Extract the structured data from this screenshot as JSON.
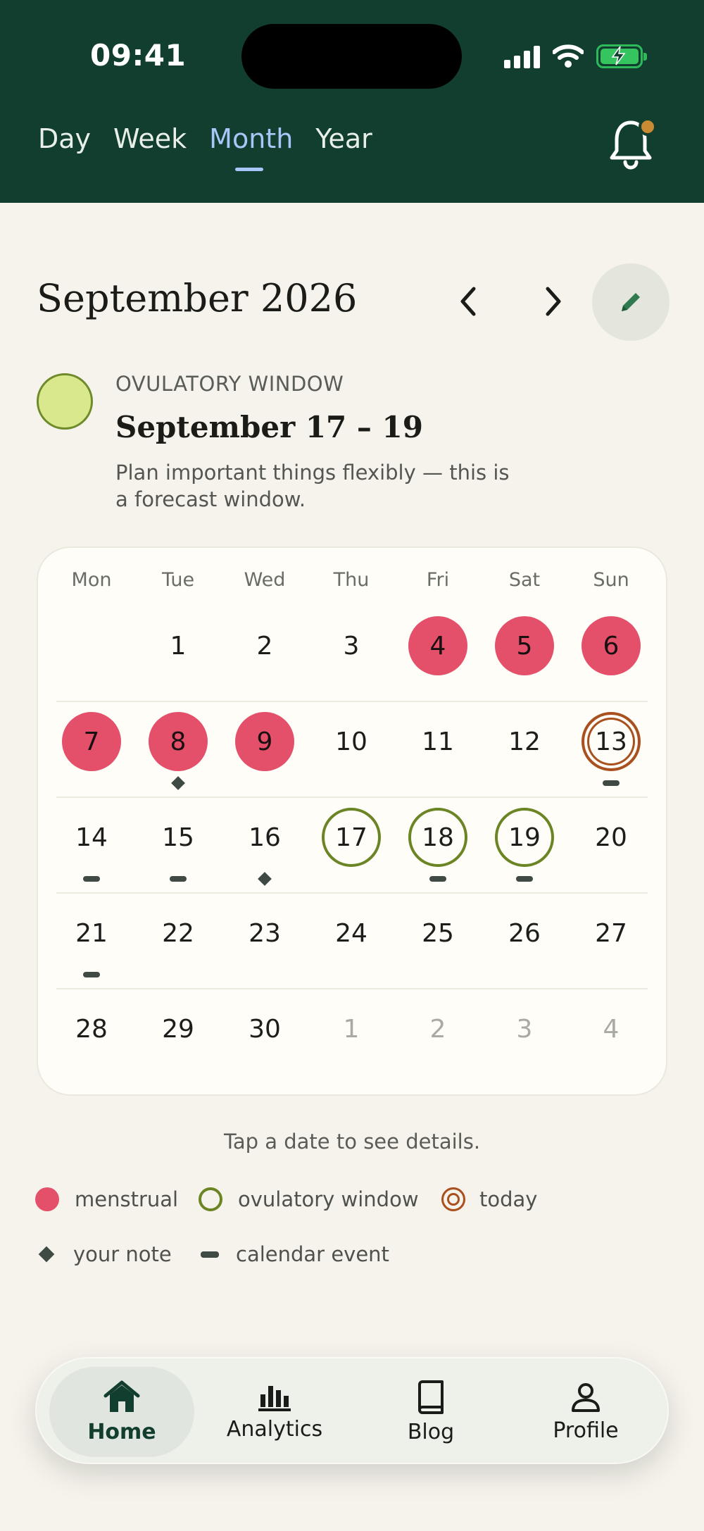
{
  "status_bar": {
    "time": "09:41"
  },
  "view_tabs": [
    "Day",
    "Week",
    "Month",
    "Year"
  ],
  "active_tab": "Month",
  "month_title": "September 2026",
  "phase": {
    "label": "OVULATORY WINDOW",
    "range": "September 17 – 19",
    "note_line1": "Plan important things flexibly — this is",
    "note_line2": "a forecast window."
  },
  "weekdays": [
    "Mon",
    "Tue",
    "Wed",
    "Thu",
    "Fri",
    "Sat",
    "Sun"
  ],
  "weeks": [
    [
      {
        "d": ""
      },
      {
        "d": "1"
      },
      {
        "d": "2"
      },
      {
        "d": "3"
      },
      {
        "d": "4",
        "s": "menstrual"
      },
      {
        "d": "5",
        "s": "menstrual"
      },
      {
        "d": "6",
        "s": "menstrual"
      }
    ],
    [
      {
        "d": "7",
        "s": "menstrual"
      },
      {
        "d": "8",
        "s": "menstrual",
        "m": "note"
      },
      {
        "d": "9",
        "s": "menstrual"
      },
      {
        "d": "10"
      },
      {
        "d": "11"
      },
      {
        "d": "12"
      },
      {
        "d": "13",
        "s": "today",
        "m": "event"
      }
    ],
    [
      {
        "d": "14",
        "m": "event"
      },
      {
        "d": "15",
        "m": "event"
      },
      {
        "d": "16",
        "m": "note"
      },
      {
        "d": "17",
        "s": "ovulatory"
      },
      {
        "d": "18",
        "s": "ovulatory",
        "m": "event"
      },
      {
        "d": "19",
        "s": "ovulatory",
        "m": "event"
      },
      {
        "d": "20"
      }
    ],
    [
      {
        "d": "21",
        "m": "event"
      },
      {
        "d": "22"
      },
      {
        "d": "23"
      },
      {
        "d": "24"
      },
      {
        "d": "25"
      },
      {
        "d": "26"
      },
      {
        "d": "27"
      }
    ],
    [
      {
        "d": "28"
      },
      {
        "d": "29"
      },
      {
        "d": "30"
      },
      {
        "d": "1",
        "s": "muted"
      },
      {
        "d": "2",
        "s": "muted"
      },
      {
        "d": "3",
        "s": "muted"
      },
      {
        "d": "4",
        "s": "muted"
      }
    ]
  ],
  "hint": "Tap a date to see details.",
  "legend": {
    "menstrual": "menstrual",
    "ovulatory": "ovulatory window",
    "today": "today",
    "note": "your note",
    "event": "calendar event"
  },
  "bottom_nav": [
    "Home",
    "Analytics",
    "Blog",
    "Profile"
  ],
  "colors": {
    "header": "#123e30",
    "menstrual": "#e4506a",
    "ovulatory": "#6b8424",
    "today": "#a9501f",
    "tab_active": "#a8c6f7"
  }
}
